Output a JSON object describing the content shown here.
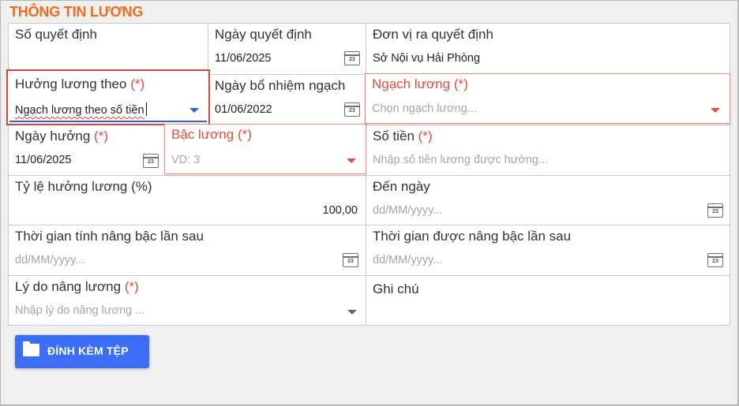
{
  "section_title": "THÔNG TIN LƯƠNG",
  "required_mark": "(*)",
  "fields": {
    "so_quyet_dinh": {
      "label": "Số quyết định",
      "value": ""
    },
    "ngay_quyet_dinh": {
      "label": "Ngày quyết định",
      "value": "11/06/2025",
      "icon": "calendar-icon"
    },
    "don_vi": {
      "label": "Đơn vị ra quyết định",
      "value": "Sở Nội vụ Hải Phòng"
    },
    "huong_luong_theo": {
      "label": "Hưởng lương theo",
      "value": "Ngạch lương theo số tiền",
      "icon": "chevron-down-icon"
    },
    "ngay_bo_nhiem": {
      "label": "Ngày bổ nhiệm ngạch",
      "value": "01/06/2022",
      "icon": "calendar-icon"
    },
    "ngach_luong": {
      "label": "Ngạch lương",
      "placeholder": "Chọn ngạch lương...",
      "icon": "chevron-down-icon"
    },
    "ngay_huong": {
      "label": "Ngày hưởng",
      "value": "11/06/2025",
      "icon": "calendar-icon"
    },
    "bac_luong": {
      "label": "Bậc lương",
      "placeholder": "VD: 3",
      "icon": "chevron-down-icon"
    },
    "so_tien": {
      "label": "Số tiền",
      "placeholder": "Nhập số tiền lương được hưởng..."
    },
    "ty_le": {
      "label": "Tỷ lệ hưởng lương (%)",
      "value": "100,00"
    },
    "den_ngay": {
      "label": "Đến ngày",
      "placeholder": "dd/MM/yyyy...",
      "icon": "calendar-icon"
    },
    "tg_tinh_nang_bac": {
      "label": "Thời gian tính nâng bậc lần sau",
      "placeholder": "dd/MM/yyyy...",
      "icon": "calendar-icon"
    },
    "tg_duoc_nang_bac": {
      "label": "Thời gian được nâng bậc lần sau",
      "placeholder": "dd/MM/yyyy...",
      "icon": "calendar-icon"
    },
    "ly_do": {
      "label": "Lý do nâng lương",
      "placeholder": "Nhập lý do nâng lương ...",
      "icon": "chevron-down-icon"
    },
    "ghi_chu": {
      "label": "Ghi chú",
      "value": ""
    }
  },
  "calendar_day": "23",
  "attach_button": {
    "label": "ĐÍNH KÈM TỆP",
    "icon": "folder-icon"
  },
  "colors": {
    "title": "#f46a1d",
    "required": "#e04a3f",
    "button": "#3b6ef5",
    "focus": "#3b5bd9"
  }
}
